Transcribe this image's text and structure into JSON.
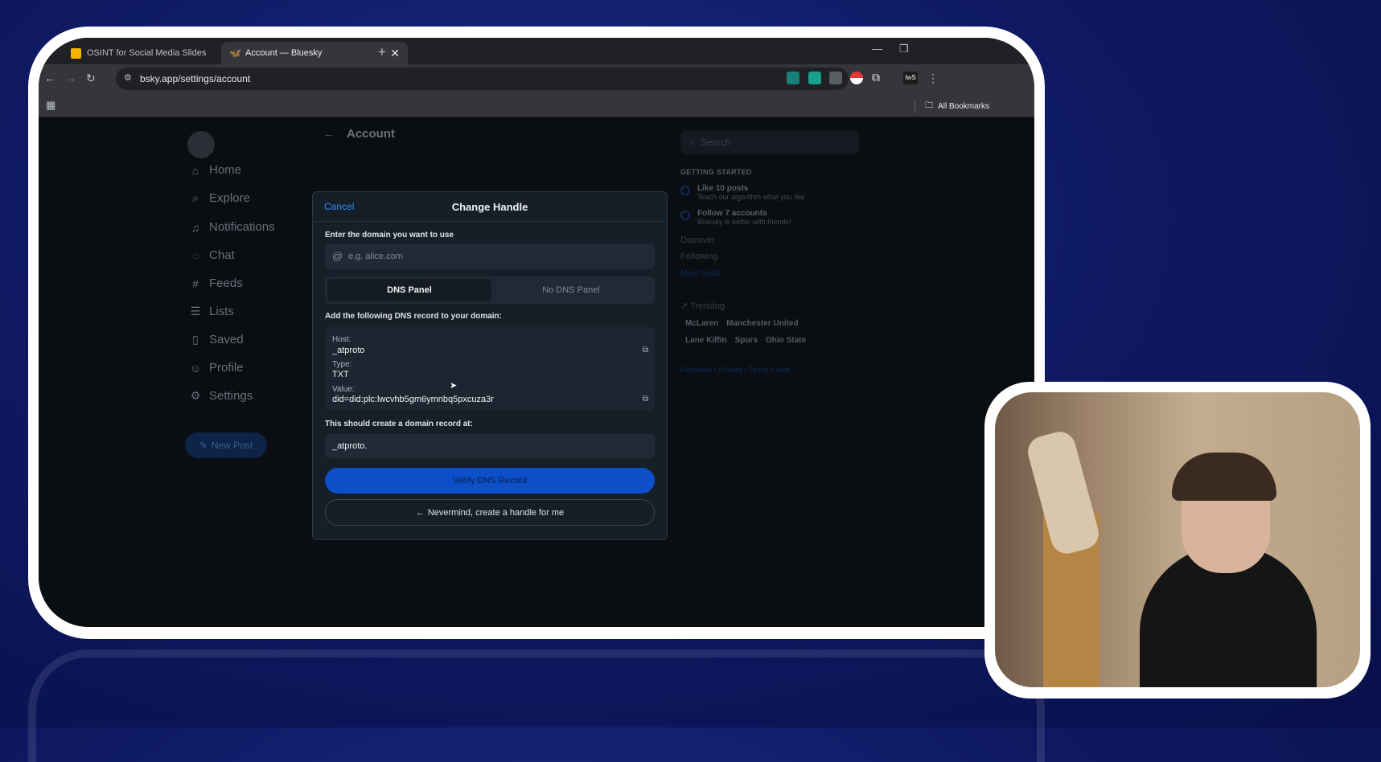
{
  "browser": {
    "tabs": [
      {
        "label": "OSINT for Social Media Slides",
        "icon": "slides-icon",
        "active": false
      },
      {
        "label": "Account — Bluesky",
        "icon": "bluesky-butterfly-icon",
        "active": true
      }
    ],
    "url": "bsky.app/settings/account",
    "all_bookmarks": "All Bookmarks",
    "profile_badge": "IwS"
  },
  "sidebar": {
    "items": [
      {
        "label": "Home",
        "icon": "home-icon"
      },
      {
        "label": "Explore",
        "icon": "search-icon"
      },
      {
        "label": "Notifications",
        "icon": "bell-icon"
      },
      {
        "label": "Chat",
        "icon": "chat-icon"
      },
      {
        "label": "Feeds",
        "icon": "hash-icon"
      },
      {
        "label": "Lists",
        "icon": "list-icon"
      },
      {
        "label": "Saved",
        "icon": "bookmark-icon"
      },
      {
        "label": "Profile",
        "icon": "profile-icon"
      },
      {
        "label": "Settings",
        "icon": "gear-icon"
      }
    ],
    "new_post": "New Post"
  },
  "account_header": {
    "title": "Account"
  },
  "right_column": {
    "search_placeholder": "Search",
    "getting_started": "GETTING STARTED",
    "tasks": [
      {
        "title": "Like 10 posts",
        "subtitle": "Teach our algorithm what you like"
      },
      {
        "title": "Follow 7 accounts",
        "subtitle": "Bluesky is better with friends!"
      }
    ],
    "feed_links": [
      "Discover",
      "Following"
    ],
    "more_feeds": "More feeds",
    "trending_title": "Trending",
    "trending_rows": [
      [
        "McLaren",
        "Manchester United"
      ],
      [
        "Lane Kiffin",
        "Spurs",
        "Ohio State"
      ]
    ],
    "footer": "Feedback • Privacy • Terms • Help"
  },
  "modal": {
    "cancel": "Cancel",
    "title": "Change Handle",
    "domain_label": "Enter the domain you want to use",
    "domain_placeholder": "e.g. alice.com",
    "tabs": [
      "DNS Panel",
      "No DNS Panel"
    ],
    "dns_instruction": "Add the following DNS record to your domain:",
    "record": {
      "host_label": "Host:",
      "host_value": "_atproto",
      "type_label": "Type:",
      "type_value": "TXT",
      "value_label": "Value:",
      "value_value": "did=did:plc:lwcvhb5gm6ymnbq5pxcuza3r"
    },
    "result_label": "This should create a domain record at:",
    "result_value": "_atproto.",
    "verify_button": "Verify DNS Record",
    "nevermind_button": "Nevermind, create a handle for me"
  }
}
